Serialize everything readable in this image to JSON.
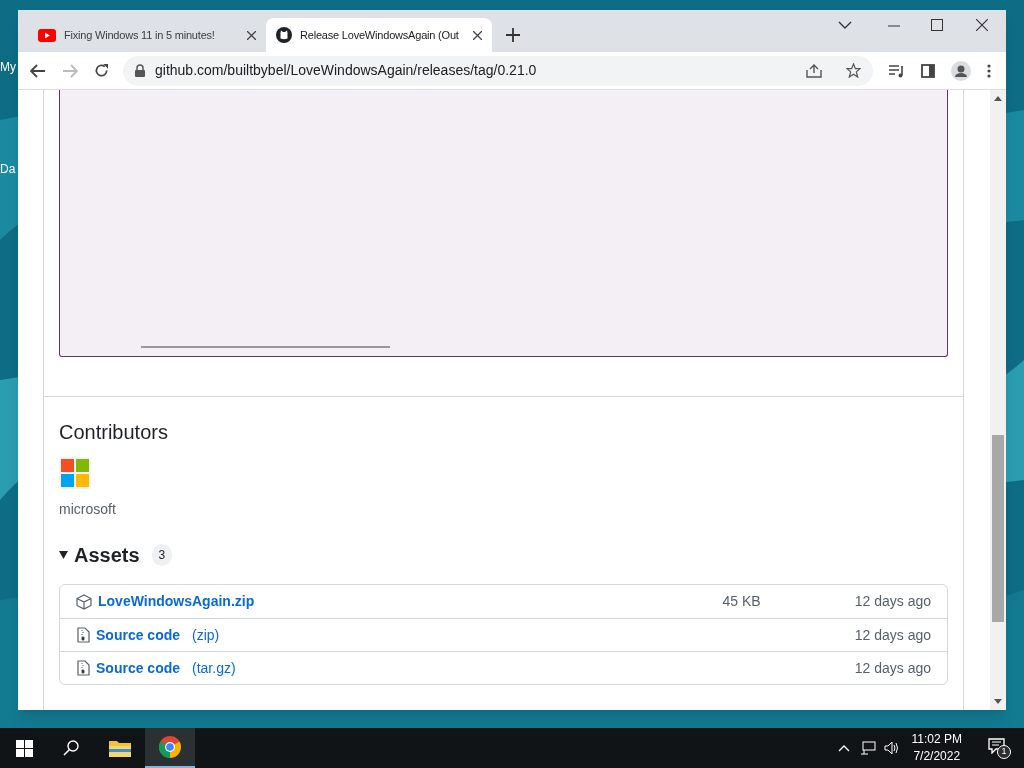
{
  "desktop": {
    "icon_labels": [
      "My",
      "Da"
    ]
  },
  "browser": {
    "tabs": [
      {
        "kind": "youtube",
        "title": "Fixing Windows 11 in 5 minutes!",
        "selected": false
      },
      {
        "kind": "github",
        "title": "Release LoveWindowsAgain (Out",
        "selected": true
      }
    ],
    "url": "github.com/builtbybel/LoveWindowsAgain/releases/tag/0.21.0"
  },
  "page": {
    "contributors": {
      "heading": "Contributors",
      "names": [
        "microsoft"
      ]
    },
    "assets": {
      "heading": "Assets",
      "count": "3",
      "expanded": true,
      "rows": [
        {
          "kind": "package",
          "name": "LoveWindowsAgain.zip",
          "size": "45 KB",
          "date": "12 days ago"
        },
        {
          "kind": "source",
          "name": "Source code",
          "suffix": "(zip)",
          "date": "12 days ago"
        },
        {
          "kind": "source",
          "name": "Source code",
          "suffix": "(tar.gz)",
          "date": "12 days ago"
        }
      ]
    }
  },
  "taskbar": {
    "apps": [
      {
        "kind": "folder",
        "selected": false
      },
      {
        "kind": "chrome",
        "selected": true
      }
    ],
    "time": "11:02 PM",
    "date": "7/2/2022",
    "notifications": "1"
  }
}
